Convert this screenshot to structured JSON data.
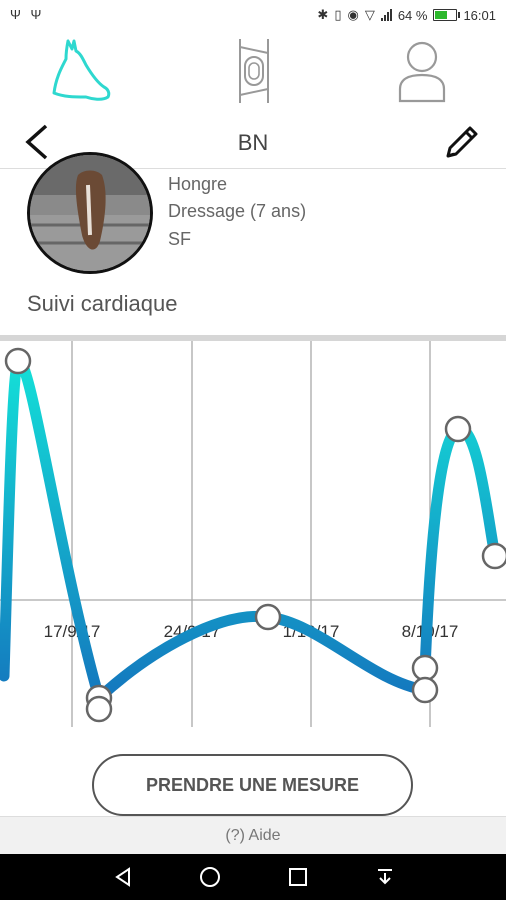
{
  "status": {
    "left_icons": "Ψ Ψ",
    "battery": "64 %",
    "battery_fraction": 0.64,
    "time": "16:01"
  },
  "tabs": [
    {
      "icon": "horse-head-icon",
      "active": true
    },
    {
      "icon": "sensor-device-icon",
      "active": false
    },
    {
      "icon": "user-icon",
      "active": false
    }
  ],
  "header": {
    "title": "BN"
  },
  "horse": {
    "gender": "Hongre",
    "discipline": "Dressage (7 ans)",
    "breed": "SF"
  },
  "section_title": "Suivi cardiaque",
  "colors": {
    "accent": "#2ed8cf",
    "line_top": "#14e0d8",
    "line_bottom": "#1477be",
    "grid": "#a9a9a9"
  },
  "chart_data": {
    "type": "line",
    "xlabels": [
      "17/9/17",
      "24/9/17",
      "1/10/17",
      "8/10/17"
    ],
    "grid": true,
    "series": [
      {
        "values": [
          "high",
          "low",
          "mid",
          "low",
          "high",
          "medium-high"
        ]
      }
    ]
  },
  "measure_button": {
    "label": "PRENDRE UNE MESURE"
  },
  "help": {
    "label": "(?) Aide"
  }
}
